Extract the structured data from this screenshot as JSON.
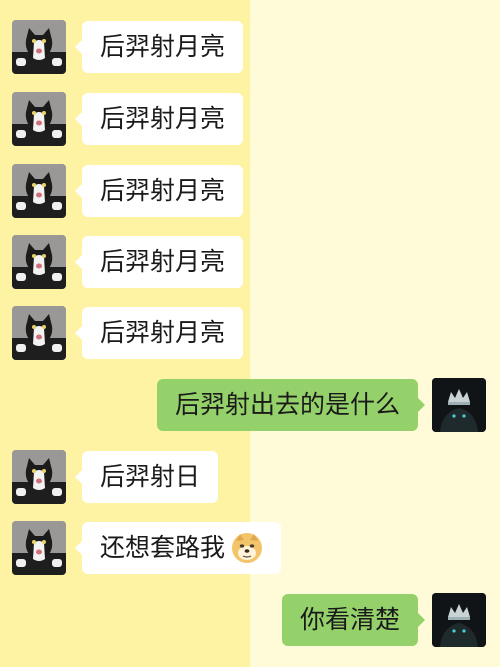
{
  "messages": [
    {
      "sender": "other",
      "text": "后羿射月亮"
    },
    {
      "sender": "other",
      "text": "后羿射月亮"
    },
    {
      "sender": "other",
      "text": "后羿射月亮"
    },
    {
      "sender": "other",
      "text": "后羿射月亮"
    },
    {
      "sender": "other",
      "text": "后羿射月亮"
    },
    {
      "sender": "self",
      "text": "后羿射出去的是什么"
    },
    {
      "sender": "other",
      "text": "后羿射日"
    },
    {
      "sender": "other",
      "text": "还想套路我",
      "emoji": "doge-emoji"
    },
    {
      "sender": "self",
      "text": "你看清楚"
    }
  ],
  "colors": {
    "left_background": "#fdf3a3",
    "right_background": "#fffbd9",
    "incoming_bubble": "#ffffff",
    "outgoing_bubble": "#95d16a"
  },
  "avatars": {
    "other": "cat-avatar-icon",
    "self": "dark-crown-avatar-icon"
  }
}
